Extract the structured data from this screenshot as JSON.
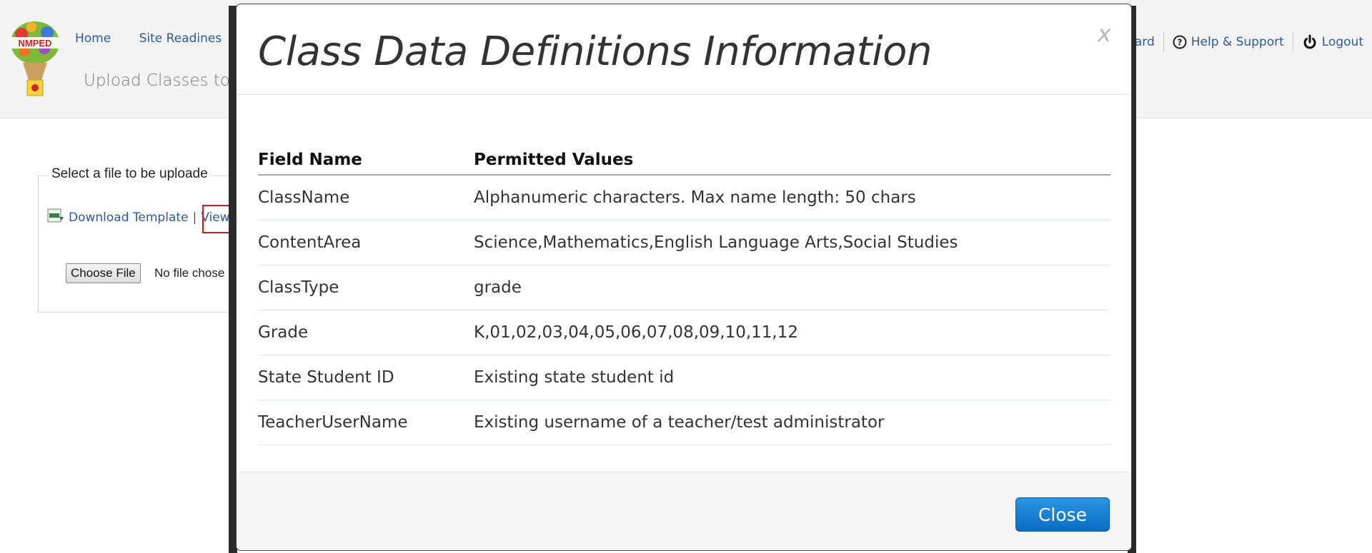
{
  "nav": {
    "home": "Home",
    "site_readiness": "Site Readines",
    "dashboard_fragment": "ard",
    "help": "Help & Support",
    "logout": "Logout"
  },
  "logo": {
    "text": "NMPED"
  },
  "page": {
    "heading": "Upload Classes to (",
    "legend": "Select a file to be uploade",
    "download_template": "Download Template",
    "link_separator": "|",
    "view_link": "View",
    "choose_file": "Choose File",
    "no_file": "No file chose"
  },
  "modal": {
    "title": "Class Data Definitions Information",
    "close_x": "x",
    "close_button": "Close",
    "headers": [
      "Field Name",
      "Permitted Values"
    ],
    "rows": [
      [
        "ClassName",
        "Alphanumeric characters. Max name length: 50 chars"
      ],
      [
        "ContentArea",
        "Science,Mathematics,English Language Arts,Social Studies"
      ],
      [
        "ClassType",
        "grade"
      ],
      [
        "Grade",
        "K,01,02,03,04,05,06,07,08,09,10,11,12"
      ],
      [
        "State Student ID",
        "Existing state student id"
      ],
      [
        "TeacherUserName",
        "Existing username of a teacher/test administrator"
      ]
    ]
  },
  "colors": {
    "link_blue": "#2a5b9a",
    "close_button_blue": "#0a6cc2",
    "highlight_red": "#d21a1a"
  }
}
